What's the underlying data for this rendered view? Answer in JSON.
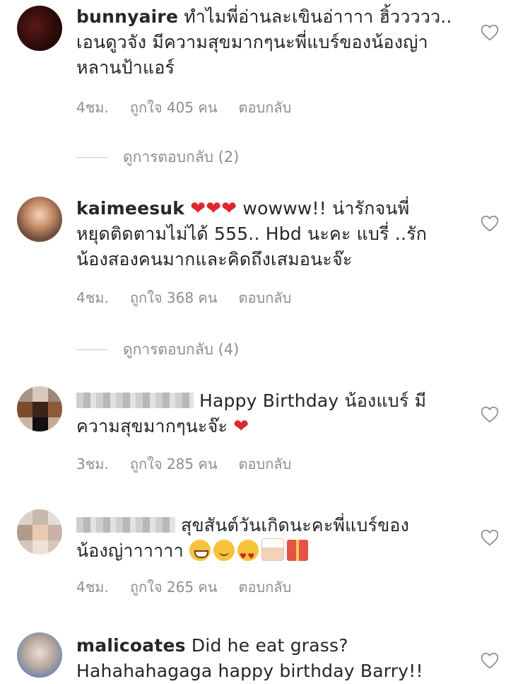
{
  "comments": [
    {
      "username": "bunnyaire",
      "text_lines": [
        "ทำไมพี่อ่านละเขินอ่าาาา ฮิ้ววววว..",
        "เอนดูวจัง มีความสุขมากๆนะพี่แบร์ของน้องญ่า",
        "หลานป้าแอร์"
      ],
      "time": "4ชม.",
      "likes": "ถูกใจ 405 คน",
      "reply_label": "ตอบกลับ",
      "view_replies": "ดูการตอบกลับ (2)"
    },
    {
      "username": "kaimeesuk",
      "text_lines": [
        "wowww!! น่ารักจนพี่",
        "หยุดติดตามไม่ได้ 555.. Hbd นะคะ แบรี่ ..รัก",
        "น้องสองคนมากและคิดถึงเสมอนะจ๊ะ"
      ],
      "hearts": "❤❤❤",
      "time": "4ชม.",
      "likes": "ถูกใจ 368 คน",
      "reply_label": "ตอบกลับ",
      "view_replies": "ดูการตอบกลับ (4)"
    },
    {
      "text_lines": [
        "Happy Birthday น้องแบร์ มี",
        "ความสุขมากๆนะจ๊ะ"
      ],
      "heart": "❤",
      "time": "3ชม.",
      "likes": "ถูกใจ 285 คน",
      "reply_label": "ตอบกลับ"
    },
    {
      "text_lines": [
        "สุขสันต์วันเกิดนะคะพี่แบร์ของ",
        "น้องญ่าาาาาา"
      ],
      "emojis": [
        "grinning-face",
        "smiling-face",
        "heart-eyes-face",
        "birthday-cake",
        "wrapped-gift"
      ],
      "time": "4ชม.",
      "likes": "ถูกใจ 265 คน",
      "reply_label": "ตอบกลับ"
    },
    {
      "username": "malicoates",
      "text_lines": [
        "Did he eat grass?",
        "Hahahahagaga happy birthday Barry!!"
      ]
    }
  ],
  "colors": {
    "text": "#262626",
    "muted": "#8e8e8e",
    "heart": "#e0262a"
  }
}
